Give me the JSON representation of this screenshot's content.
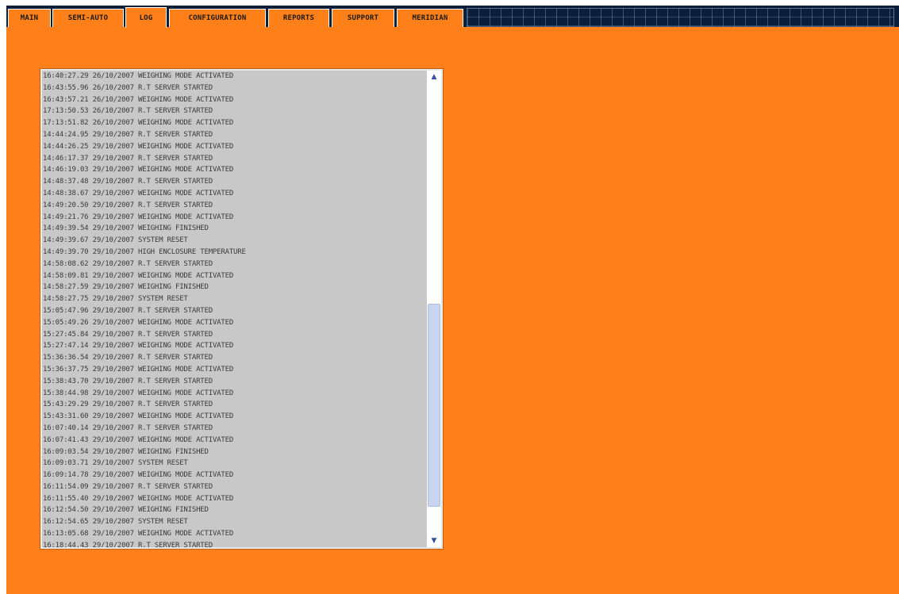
{
  "tabs": [
    {
      "label": "MAIN",
      "active": false
    },
    {
      "label": "SEMI-AUTO",
      "active": false
    },
    {
      "label": "LOG",
      "active": true
    },
    {
      "label": "CONFIGURATION",
      "active": false
    },
    {
      "label": "REPORTS",
      "active": false
    },
    {
      "label": "SUPPORT",
      "active": false
    },
    {
      "label": "MERIDIAN",
      "active": false
    }
  ],
  "log": {
    "lines": [
      "16:40:27.29 26/10/2007 WEIGHING MODE ACTIVATED",
      "16:43:55.96 26/10/2007 R.T SERVER STARTED",
      "16:43:57.21 26/10/2007 WEIGHING MODE ACTIVATED",
      "17:13:50.53 26/10/2007 R.T SERVER STARTED",
      "17:13:51.82 26/10/2007 WEIGHING MODE ACTIVATED",
      "14:44:24.95 29/10/2007 R.T SERVER STARTED",
      "14:44:26.25 29/10/2007 WEIGHING MODE ACTIVATED",
      "14:46:17.37 29/10/2007 R.T SERVER STARTED",
      "14:46:19.03 29/10/2007 WEIGHING MODE ACTIVATED",
      "14:48:37.48 29/10/2007 R.T SERVER STARTED",
      "14:48:38.67 29/10/2007 WEIGHING MODE ACTIVATED",
      "14:49:20.50 29/10/2007 R.T SERVER STARTED",
      "14:49:21.76 29/10/2007 WEIGHING MODE ACTIVATED",
      "14:49:39.54 29/10/2007 WEIGHING FINISHED",
      "14:49:39.67 29/10/2007 SYSTEM RESET",
      "14:49:39.70 29/10/2007 HIGH ENCLOSURE TEMPERATURE",
      "14:58:08.62 29/10/2007 R.T SERVER STARTED",
      "14:58:09.81 29/10/2007 WEIGHING MODE ACTIVATED",
      "14:58:27.59 29/10/2007 WEIGHING FINISHED",
      "14:58:27.75 29/10/2007 SYSTEM RESET",
      "15:05:47.96 29/10/2007 R.T SERVER STARTED",
      "15:05:49.26 29/10/2007 WEIGHING MODE ACTIVATED",
      "15:27:45.84 29/10/2007 R.T SERVER STARTED",
      "15:27:47.14 29/10/2007 WEIGHING MODE ACTIVATED",
      "15:36:36.54 29/10/2007 R.T SERVER STARTED",
      "15:36:37.75 29/10/2007 WEIGHING MODE ACTIVATED",
      "15:38:43.70 29/10/2007 R.T SERVER STARTED",
      "15:38:44.98 29/10/2007 WEIGHING MODE ACTIVATED",
      "15:43:29.29 29/10/2007 R.T SERVER STARTED",
      "15:43:31.60 29/10/2007 WEIGHING MODE ACTIVATED",
      "16:07:40.14 29/10/2007 R.T SERVER STARTED",
      "16:07:41.43 29/10/2007 WEIGHING MODE ACTIVATED",
      "16:09:03.54 29/10/2007 WEIGHING FINISHED",
      "16:09:03.71 29/10/2007 SYSTEM RESET",
      "16:09:14.78 29/10/2007 WEIGHING MODE ACTIVATED",
      "16:11:54.09 29/10/2007 R.T SERVER STARTED",
      "16:11:55.40 29/10/2007 WEIGHING MODE ACTIVATED",
      "16:12:54.50 29/10/2007 WEIGHING FINISHED",
      "16:12:54.65 29/10/2007 SYSTEM RESET",
      "16:13:05.68 29/10/2007 WEIGHING MODE ACTIVATED",
      "16:18:44.43 29/10/2007 R.T SERVER STARTED"
    ]
  },
  "scrollbar": {
    "up_icon": "chevron-up-icon",
    "down_icon": "chevron-down-icon"
  },
  "colors": {
    "panel": "#ff7f1a",
    "navy": "#0b1f3a",
    "log_background": "#c8c8c8"
  }
}
